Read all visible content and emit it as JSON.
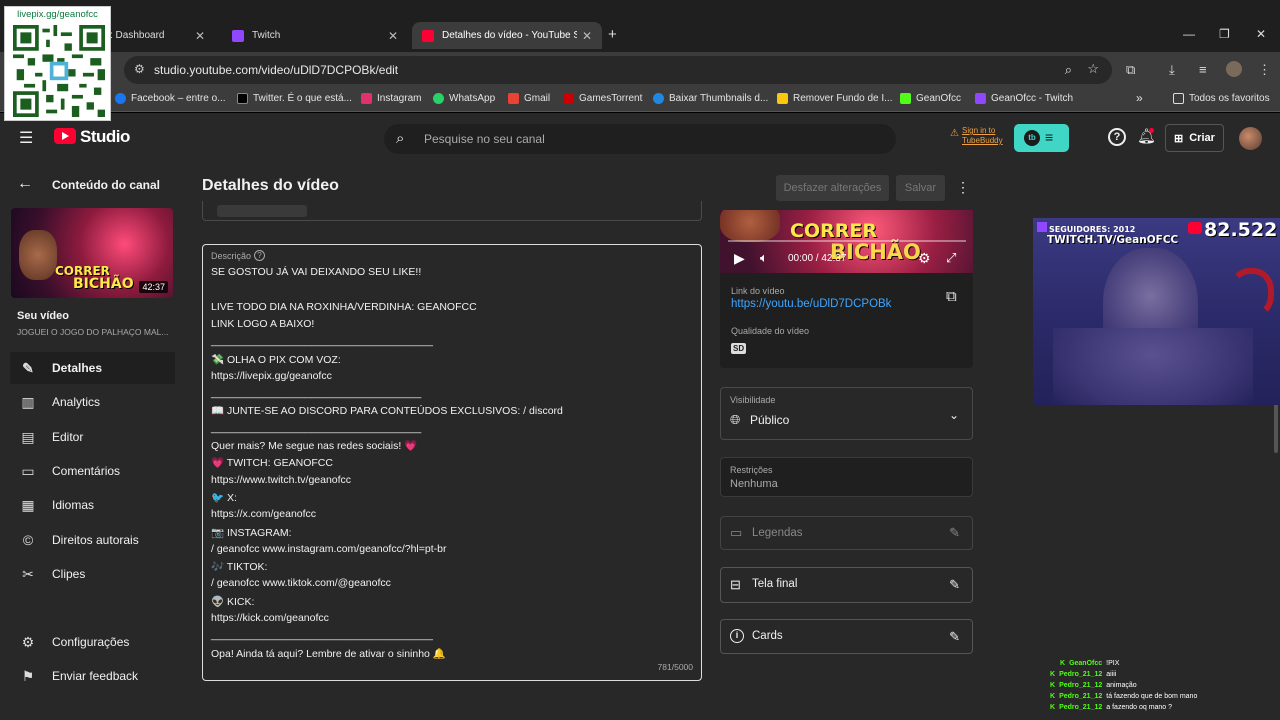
{
  "browser": {
    "tabs": [
      {
        "title": ": Dashboard",
        "color": "#8b8b8b"
      },
      {
        "title": "Twitch",
        "color": "#9146ff"
      },
      {
        "title": "Detalhes do vídeo - YouTube St",
        "color": "#ff0033"
      }
    ],
    "url": "studio.youtube.com/video/uDlD7DCPOBk/edit",
    "bookmarks": [
      {
        "label": "Facebook – entre o...",
        "color": "#1877f2"
      },
      {
        "label": "Twitter. É o que está...",
        "color": "#000000"
      },
      {
        "label": "Instagram",
        "color": "#e1306c"
      },
      {
        "label": "WhatsApp",
        "color": "#25d366"
      },
      {
        "label": "Gmail",
        "color": "#ea4335"
      },
      {
        "label": "GamesTorrent",
        "color": "#cc0000"
      },
      {
        "label": "Baixar Thumbnails d...",
        "color": "#1e88e5"
      },
      {
        "label": "Remover Fundo de I...",
        "color": "#f9c80e"
      },
      {
        "label": "GeanOfcc",
        "color": "#53fc18"
      },
      {
        "label": "GeanOfcc - Twitch",
        "color": "#9146ff"
      }
    ],
    "bookmarks_more": "»",
    "all_favorites": "Todos os favoritos"
  },
  "qr": {
    "text": "livepix.gg/geanofcc"
  },
  "header": {
    "logo": "Studio",
    "search_placeholder": "Pesquise no seu canal",
    "tubebuddy_signin": "Sign in to TubeBuddy",
    "create_label": "Criar"
  },
  "sidebar": {
    "back_label": "Conteúdo do canal",
    "thumb_duration": "42:37",
    "thumb_title_1": "CORRER",
    "thumb_title_2": "BICHÃO",
    "your_video": "Seu vídeo",
    "video_title": "JOGUEI O JOGO DO PALHAÇO MAL...",
    "items": [
      {
        "label": "Detalhes",
        "icon": "pencil-icon",
        "glyph": "✎"
      },
      {
        "label": "Analytics",
        "icon": "analytics-icon",
        "glyph": "▥"
      },
      {
        "label": "Editor",
        "icon": "editor-icon",
        "glyph": "▤"
      },
      {
        "label": "Comentários",
        "icon": "comments-icon",
        "glyph": "▭"
      },
      {
        "label": "Idiomas",
        "icon": "languages-icon",
        "glyph": "▦"
      },
      {
        "label": "Direitos autorais",
        "icon": "copyright-icon",
        "glyph": "©"
      },
      {
        "label": "Clipes",
        "icon": "scissors-icon",
        "glyph": "✂"
      }
    ],
    "settings": "Configurações",
    "feedback": "Enviar feedback"
  },
  "main": {
    "title": "Detalhes do vídeo",
    "undo": "Desfazer alterações",
    "save": "Salvar",
    "description_label": "Descrição",
    "description_lines": [
      "SE GOSTOU JÁ VAI DEIXANDO SEU LIKE!!",
      "",
      "LIVE TODO DIA NA ROXINHA/VERDINHA: GEANOFCC",
      "LINK LOGO A BAIXO!",
      "______________________________________",
      "💸 OLHA O PIX COM VOZ:",
      "https://livepix.gg/geanofcc",
      "____________________________________",
      "📖 JUNTE-SE AO DISCORD PARA CONTEÚDOS EXCLUSIVOS:   / discord",
      "____________________________________",
      "Quer mais? Me segue nas redes sociais! 💗",
      "💗 TWITCH: GEANOFCC",
      "https://www.twitch.tv/geanofcc",
      "🐦 X:",
      "https://x.com/geanofcc",
      "📷 INSTAGRAM:",
      "  / geanofcc www.instagram.com/geanofcc/?hl=pt-br",
      "🎶 TIKTOK:",
      "  / geanofcc www.tiktok.com/@geanofcc",
      "👽 KICK:",
      "https://kick.com/geanofcc",
      "______________________________________",
      "Opa! Ainda tá aqui? Lembre de ativar o sininho 🔔"
    ],
    "char_count": "781/5000",
    "player_time": "00:00 / 42:37",
    "video_link_label": "Link do vídeo",
    "video_link": "https://youtu.be/uDlD7DCPOBk",
    "quality_label": "Qualidade do vídeo",
    "quality_badge": "SD",
    "visibility_label": "Visibilidade",
    "visibility_value": "Público",
    "restrictions_label": "Restrições",
    "restrictions_value": "Nenhuma",
    "subtitles": "Legendas",
    "end_screen": "Tela final",
    "cards": "Cards"
  },
  "stream_overlay": {
    "followers_label": "SEGUIDORES: 2012",
    "twitch_handle": "TWITCH.TV/GeanOFCC",
    "yt_count": "82.522"
  },
  "chat": [
    {
      "user": "GeanOfcc",
      "msg": "!PIX",
      "color": "#53fc18"
    },
    {
      "user": "Pedro_21_12",
      "msg": "aiiii",
      "color": "#53fc18"
    },
    {
      "user": "Pedro_21_12",
      "msg": "animação",
      "color": "#53fc18"
    },
    {
      "user": "Pedro_21_12",
      "msg": "tá fazendo que de bom mano",
      "color": "#53fc18"
    },
    {
      "user": "Pedro_21_12",
      "msg": "a fazendo oq mano ?",
      "color": "#53fc18"
    }
  ],
  "colors": {
    "accent_link": "#3ea6ff",
    "bg": "#282828",
    "yt_red": "#ff0033"
  }
}
